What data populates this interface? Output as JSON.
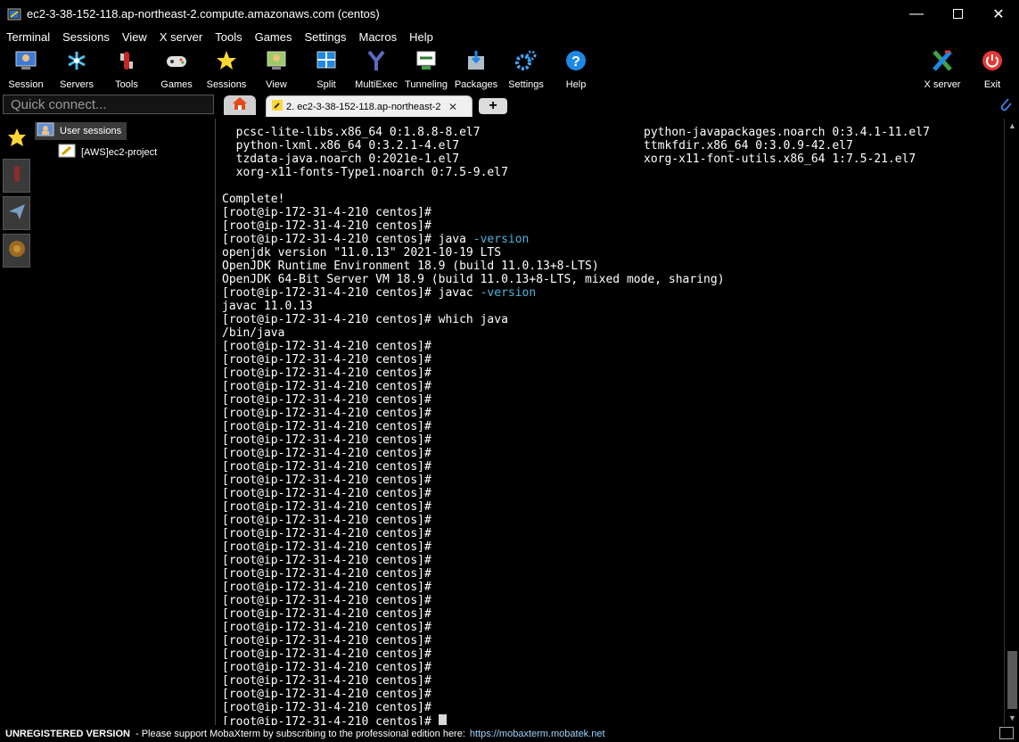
{
  "window": {
    "title": "ec2-3-38-152-118.ap-northeast-2.compute.amazonaws.com (centos)",
    "minimize": "—",
    "maximize": "☐",
    "close": "✕"
  },
  "menu": [
    "Terminal",
    "Sessions",
    "View",
    "X server",
    "Tools",
    "Games",
    "Settings",
    "Macros",
    "Help"
  ],
  "toolbar": [
    {
      "label": "Session",
      "icon": "session-icon"
    },
    {
      "label": "Servers",
      "icon": "servers-icon"
    },
    {
      "label": "Tools",
      "icon": "tools-icon"
    },
    {
      "label": "Games",
      "icon": "games-icon"
    },
    {
      "label": "Sessions",
      "icon": "sessions-star-icon"
    },
    {
      "label": "View",
      "icon": "view-icon"
    },
    {
      "label": "Split",
      "icon": "split-icon"
    },
    {
      "label": "MultiExec",
      "icon": "multiexec-icon"
    },
    {
      "label": "Tunneling",
      "icon": "tunneling-icon"
    },
    {
      "label": "Packages",
      "icon": "packages-icon"
    },
    {
      "label": "Settings",
      "icon": "settings-icon"
    },
    {
      "label": "Help",
      "icon": "help-icon"
    },
    {
      "label": "X server",
      "icon": "x-server-icon"
    },
    {
      "label": "Exit",
      "icon": "exit-icon"
    }
  ],
  "quick_connect": {
    "placeholder": "Quick connect..."
  },
  "tabs": {
    "active_label": "2. ec2-3-38-152-118.ap-northeast-2",
    "close": "✕",
    "new": "+"
  },
  "sessions_tree": {
    "root": "User sessions",
    "child": "[AWS]ec2-project"
  },
  "terminal": {
    "package_lines": [
      [
        "pcsc-lite-libs.x86_64 0:1.8.8-8.el7",
        "python-javapackages.noarch 0:3.4.1-11.el7"
      ],
      [
        "python-lxml.x86_64 0:3.2.1-4.el7",
        "ttmkfdir.x86_64 0:3.0.9-42.el7"
      ],
      [
        "tzdata-java.noarch 0:2021e-1.el7",
        "xorg-x11-font-utils.x86_64 1:7.5-21.el7"
      ],
      [
        "xorg-x11-fonts-Type1.noarch 0:7.5-9.el7",
        ""
      ]
    ],
    "complete": "Complete!",
    "prompt": "[root@ip-172-31-4-210 centos]#",
    "cmd_java": "java",
    "cmd_java_flag": "-version",
    "java_out": [
      "openjdk version \"11.0.13\" 2021-10-19 LTS",
      "OpenJDK Runtime Environment 18.9 (build 11.0.13+8-LTS)",
      "OpenJDK 64-Bit Server VM 18.9 (build 11.0.13+8-LTS, mixed mode, sharing)"
    ],
    "cmd_javac": "javac",
    "cmd_javac_flag": "-version",
    "javac_out": "javac 11.0.13",
    "cmd_which": "which java",
    "which_out": "/bin/java",
    "empty_prompt_count": 28
  },
  "status": {
    "unregistered": "UNREGISTERED VERSION",
    "message": "-  Please support MobaXterm by subscribing to the professional edition here:",
    "link": "https://mobaxterm.mobatek.net"
  },
  "colors": {
    "keyword": "#4fb3d9",
    "link": "#9fd4ff"
  }
}
